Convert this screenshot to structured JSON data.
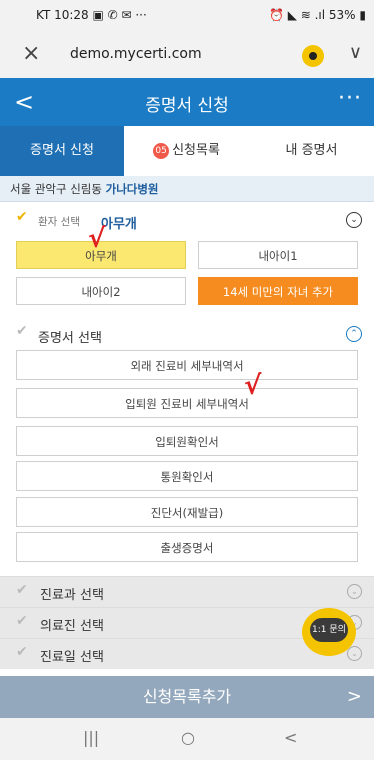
{
  "status": {
    "left": "KT 10:28 ▣ ✆ ✉ ···",
    "right": "⏰ ◣ ≋ .ıl 53% ▮"
  },
  "browser": {
    "url": "demo.mycerti.com",
    "close_icon": "×",
    "menu_icon": "∨"
  },
  "header": {
    "back": "<",
    "title": "증명서 신청",
    "more": "···"
  },
  "tabs": [
    {
      "label": "증명서 신청"
    },
    {
      "label": "신청목록",
      "badge": "05"
    },
    {
      "label": "내 증명서"
    }
  ],
  "hospital": {
    "location": "서울 관악구 신림동 ",
    "name": "가나다병원"
  },
  "patient_section": {
    "label": "환자 선택",
    "selected": "아무개",
    "toggle_icon": "⌄"
  },
  "patients": [
    "아무개",
    "내아이1",
    "내아이2",
    "14세 미만의 자녀 추가"
  ],
  "cert_section": {
    "label": "증명서 선택",
    "toggle_icon": "⌃"
  },
  "certificates": [
    "외래 진료비 세부내역서",
    "입퇴원 진료비 세부내역서",
    "입퇴원확인서",
    "통원확인서",
    "진단서(재발급)",
    "출생증명서"
  ],
  "collapsed_sections": [
    "진료과 선택",
    "의료진 선택",
    "진료일 선택"
  ],
  "chat": {
    "label": "1:1 문의"
  },
  "add_button": {
    "label": "신청목록추가",
    "arrow": ">"
  },
  "nav": {
    "recents": "|||",
    "home": "○",
    "back": "<"
  },
  "marks": {
    "check": "√"
  }
}
